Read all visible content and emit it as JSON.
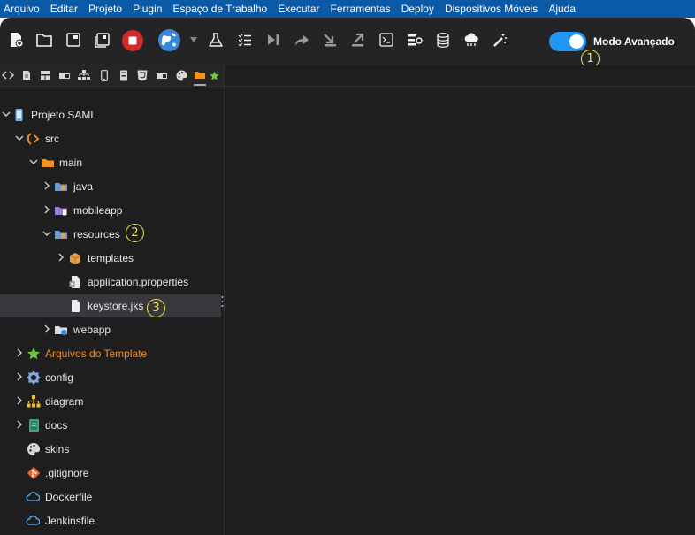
{
  "menu": [
    "Arquivo",
    "Editar",
    "Projeto",
    "Plugin",
    "Espaço de Trabalho",
    "Executar",
    "Ferramentas",
    "Deploy",
    "Dispositivos Móveis",
    "Ajuda"
  ],
  "toolbar": {
    "buttons": [
      "new-file-icon",
      "open-folder-icon",
      "save-icon",
      "save-all-icon",
      "stop-icon",
      "globe-icon",
      "dropdown-arrow-icon",
      "flask-icon",
      "checklist-icon",
      "step-icon",
      "redo-icon",
      "download-icon",
      "upload-icon",
      "terminal-icon",
      "settings-list-icon",
      "database-icon",
      "cloud-icon",
      "magic-wand-icon"
    ],
    "advanced_mode_label": "Modo Avançado",
    "advanced_mode_on": true
  },
  "callouts": [
    "1",
    "2",
    "3"
  ],
  "panel_icons": [
    "code-icon",
    "file-icon",
    "layout-icon",
    "package-icon",
    "hierarchy-icon",
    "mobile-icon",
    "server-icon",
    "html5-icon",
    "folder-module-icon",
    "palette-icon",
    "orange-folder-icon",
    "star-icon"
  ],
  "tree": [
    {
      "label": "Projeto SAML",
      "icon": "project-icon",
      "level": 0,
      "expanded": true
    },
    {
      "label": "src",
      "icon": "source-icon",
      "level": 1,
      "expanded": true
    },
    {
      "label": "main",
      "icon": "folder-icon",
      "level": 2,
      "expanded": true
    },
    {
      "label": "java",
      "icon": "package-folder-icon",
      "level": 3,
      "expanded": false
    },
    {
      "label": "mobileapp",
      "icon": "mobile-folder-icon",
      "level": 3,
      "expanded": false
    },
    {
      "label": "resources",
      "icon": "package-folder-icon",
      "level": 3,
      "expanded": true
    },
    {
      "label": "templates",
      "icon": "box-icon",
      "level": 4,
      "expanded": false
    },
    {
      "label": "application.properties",
      "icon": "properties-file-icon",
      "level": 4
    },
    {
      "label": "keystore.jks",
      "icon": "file-icon",
      "level": 4,
      "selected": true
    },
    {
      "label": "webapp",
      "icon": "web-folder-icon",
      "level": 3,
      "expanded": false
    },
    {
      "label": "Arquivos do Template",
      "icon": "star-icon",
      "level": 1,
      "expanded": false,
      "highlight": true
    },
    {
      "label": "config",
      "icon": "gear-icon",
      "level": 1,
      "expanded": false
    },
    {
      "label": "diagram",
      "icon": "hierarchy-icon",
      "level": 1,
      "expanded": false
    },
    {
      "label": "docs",
      "icon": "book-icon",
      "level": 1,
      "expanded": false
    },
    {
      "label": "skins",
      "icon": "palette-icon",
      "level": 1
    },
    {
      "label": ".gitignore",
      "icon": "git-icon",
      "level": 1
    },
    {
      "label": "Dockerfile",
      "icon": "cloud-icon",
      "level": 1
    },
    {
      "label": "Jenkinsfile",
      "icon": "cloud-icon",
      "level": 1
    }
  ],
  "colors": {
    "menu_bg": "#0a5aa8",
    "toolbar_bg": "#242426",
    "toggle_on": "#2196f3",
    "callout": "#e8e84a",
    "highlight_text": "#f08a24",
    "selected_row": "#37373d"
  }
}
